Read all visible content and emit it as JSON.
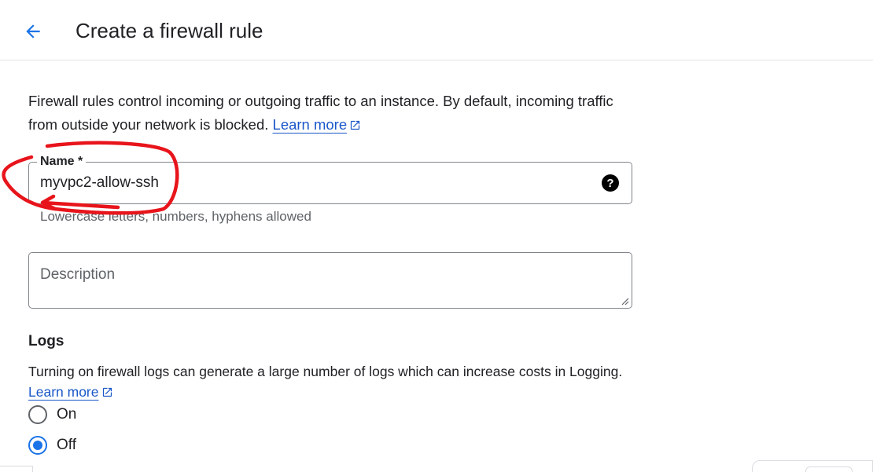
{
  "header": {
    "title": "Create a firewall rule",
    "back_icon": "arrow-left-icon"
  },
  "intro": {
    "text": "Firewall rules control incoming or outgoing traffic to an instance. By default, incoming traffic from outside your network is blocked.",
    "link_label": "Learn more"
  },
  "name_field": {
    "label": "Name *",
    "value": "myvpc2-allow-ssh",
    "hint": "Lowercase letters, numbers, hyphens allowed",
    "help_icon_glyph": "?"
  },
  "description_field": {
    "placeholder": "Description"
  },
  "logs": {
    "title": "Logs",
    "text": "Turning on firewall logs can generate a large number of logs which can increase costs in Logging.",
    "link_label": "Learn more",
    "options": [
      {
        "label": "On",
        "selected": false
      },
      {
        "label": "Off",
        "selected": true
      }
    ]
  },
  "colors": {
    "accent": "#1a73e8",
    "link": "#1a57c9",
    "annotation": "#e8141b"
  }
}
